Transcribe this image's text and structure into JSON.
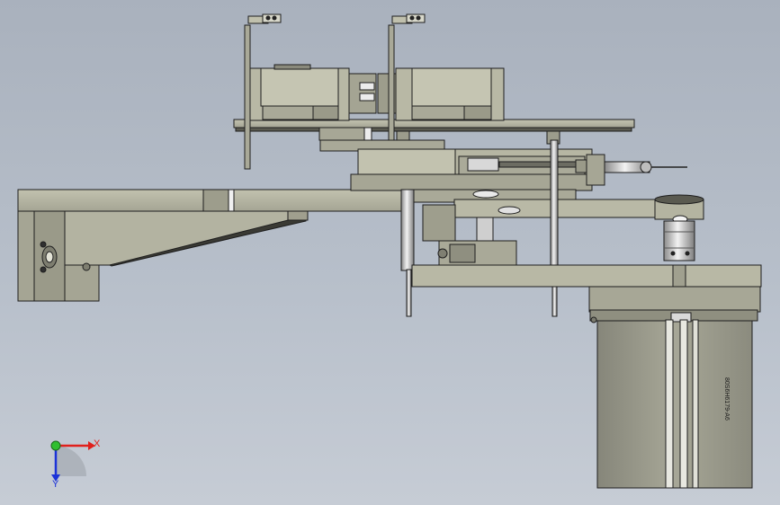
{
  "viewport": {
    "part_label": "80S6H6179-A6"
  },
  "triad": {
    "x_label": "X",
    "y_label": "Y",
    "x_color": "#e0201c",
    "y_color": "#1c33d8",
    "origin_color": "#2fbf2f"
  },
  "colors": {
    "background_top": "#a9b1bd",
    "background_bottom": "#c6ccd5",
    "part_face": "#b9b9a6",
    "part_face_dark": "#8e8e7e",
    "edge": "#1e1e1e",
    "steel": "#d6d6d6",
    "motor_body": "#9c9c8c"
  }
}
